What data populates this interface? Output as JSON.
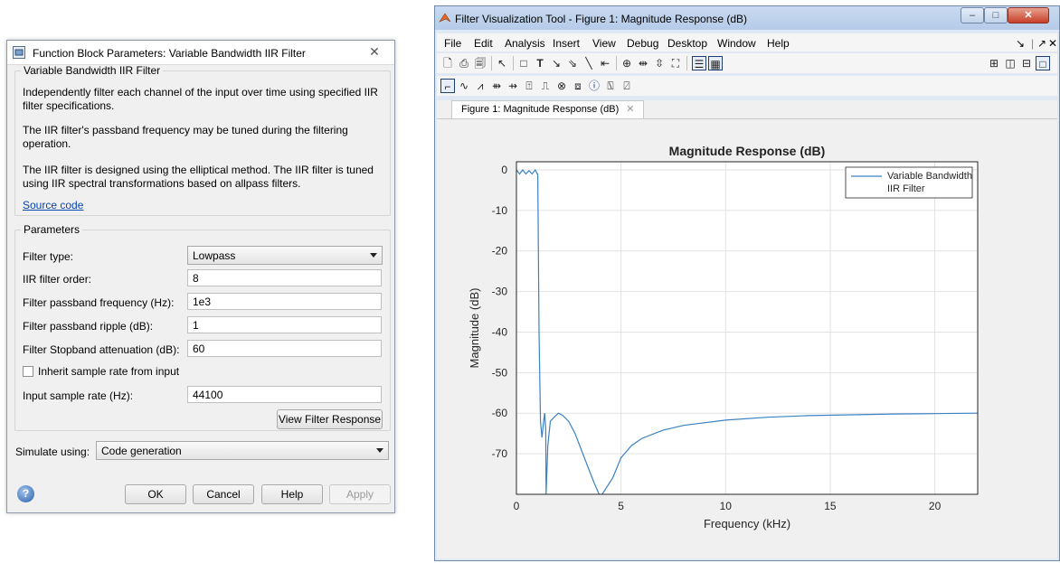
{
  "dialog": {
    "title": "Function Block Parameters: Variable Bandwidth IIR Filter",
    "group_title": "Variable Bandwidth IIR Filter",
    "description_1_line1": "Independently filter each channel of the input over time using specified IIR",
    "description_1_line2": "filter specifications.",
    "description_2_line1": "The IIR filter's passband frequency may be tuned during the filtering",
    "description_2_line2": "operation.",
    "description_3_line1": "The IIR filter is designed using the elliptical method. The IIR filter is tuned",
    "description_3_line2": "using IIR spectral transformations based on allpass filters.",
    "source_link": "Source code",
    "params_title": "Parameters",
    "filter_type_label": "Filter type:",
    "filter_type_value": "Lowpass",
    "order_label": "IIR filter order:",
    "order_value": "8",
    "passband_freq_label": "Filter passband frequency (Hz):",
    "passband_freq_value": "1e3",
    "ripple_label": "Filter passband ripple (dB):",
    "ripple_value": "1",
    "stopband_label": "Filter Stopband attenuation (dB):",
    "stopband_value": "60",
    "inherit_label": "Inherit sample rate from input",
    "inherit_checked": false,
    "sample_rate_label": "Input sample rate (Hz):",
    "sample_rate_value": "44100",
    "view_response_button": "View Filter Response",
    "simulate_label": "Simulate using:",
    "simulate_value": "Code generation",
    "ok_button": "OK",
    "cancel_button": "Cancel",
    "help_button": "Help",
    "apply_button": "Apply"
  },
  "fvtool": {
    "title": "Filter Visualization Tool - Figure 1: Magnitude Response (dB)",
    "menu": [
      "File",
      "Edit",
      "Analysis",
      "Insert",
      "View",
      "Debug",
      "Desktop",
      "Window",
      "Help"
    ],
    "tab_label": "Figure 1: Magnitude Response (dB)"
  },
  "chart_data": {
    "type": "line",
    "title": "Magnitude Response (dB)",
    "xlabel": "Frequency (kHz)",
    "ylabel": "Magnitude (dB)",
    "xlim": [
      0,
      22.05
    ],
    "ylim": [
      -80,
      2
    ],
    "xticks": [
      0,
      5,
      10,
      15,
      20
    ],
    "yticks": [
      0,
      -10,
      -20,
      -30,
      -40,
      -50,
      -60,
      -70
    ],
    "grid": true,
    "legend": {
      "position": "top-right",
      "entries": [
        "Variable Bandwidth IIR Filter"
      ]
    },
    "series": [
      {
        "name": "Variable Bandwidth IIR Filter",
        "color": "#3a82c4",
        "x": [
          0,
          0.15,
          0.3,
          0.45,
          0.6,
          0.75,
          0.9,
          1.0,
          1.02,
          1.08,
          1.15,
          1.22,
          1.3,
          1.35,
          1.4,
          1.42,
          1.5,
          1.62,
          1.8,
          2.0,
          2.2,
          2.5,
          2.8,
          3.1,
          3.4,
          3.7,
          3.95,
          4.1,
          4.6,
          5.0,
          5.5,
          6.0,
          7.0,
          8.0,
          10.0,
          12.0,
          14.0,
          16.0,
          18.0,
          20.0,
          22.05
        ],
        "y": [
          0,
          -1,
          0,
          -1,
          -0.2,
          -1,
          0,
          -1,
          -1,
          -40,
          -62,
          -66,
          -62,
          -60,
          -64,
          -80,
          -68,
          -62,
          -61,
          -60,
          -60.5,
          -62,
          -65,
          -69,
          -73,
          -77,
          -80,
          -80,
          -76,
          -71,
          -68,
          -66.2,
          -64.2,
          -63,
          -61.7,
          -61,
          -60.6,
          -60.4,
          -60.2,
          -60.1,
          -60
        ]
      }
    ]
  }
}
